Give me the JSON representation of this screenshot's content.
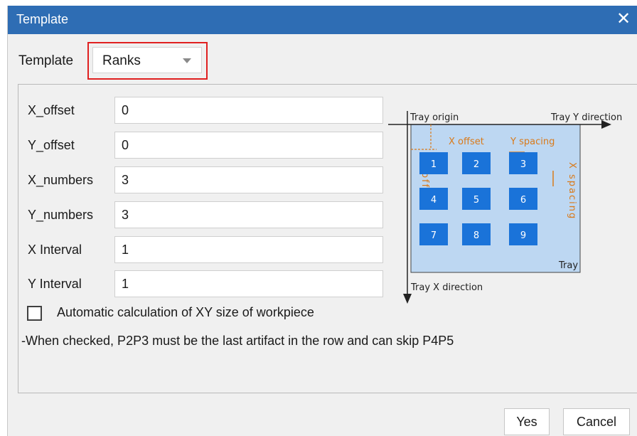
{
  "dialog": {
    "title": "Template",
    "close_icon": "close-icon"
  },
  "template": {
    "label": "Template",
    "selected": "Ranks"
  },
  "fields": [
    {
      "label": "X_offset",
      "value": "0"
    },
    {
      "label": "Y_offset",
      "value": "0"
    },
    {
      "label": "X_numbers",
      "value": "3"
    },
    {
      "label": "Y_numbers",
      "value": "3"
    },
    {
      "label": "X Interval",
      "value": "1"
    },
    {
      "label": "Y Interval",
      "value": "1"
    }
  ],
  "auto_calc": {
    "checked": false,
    "label": "Automatic calculation of XY size of workpiece"
  },
  "note": "-When checked, P2P3 must be the last artifact in the row and can skip P4P5",
  "diagram": {
    "tray_origin": "Tray origin",
    "tray_y_direction": "Tray Y direction",
    "tray_x_direction": "Tray X direction",
    "x_offset": "X offset",
    "y_spacing": "Y spacing",
    "y_offset": "Y offset",
    "x_spacing": "X spacing",
    "tray": "Tray",
    "cells": [
      "1",
      "2",
      "3",
      "4",
      "5",
      "6",
      "7",
      "8",
      "9"
    ],
    "colors": {
      "tray_fill": "#bdd7f2",
      "cell_fill": "#1a73d9",
      "annotation": "#d97a1a"
    }
  },
  "buttons": {
    "yes": "Yes",
    "cancel": "Cancel"
  }
}
